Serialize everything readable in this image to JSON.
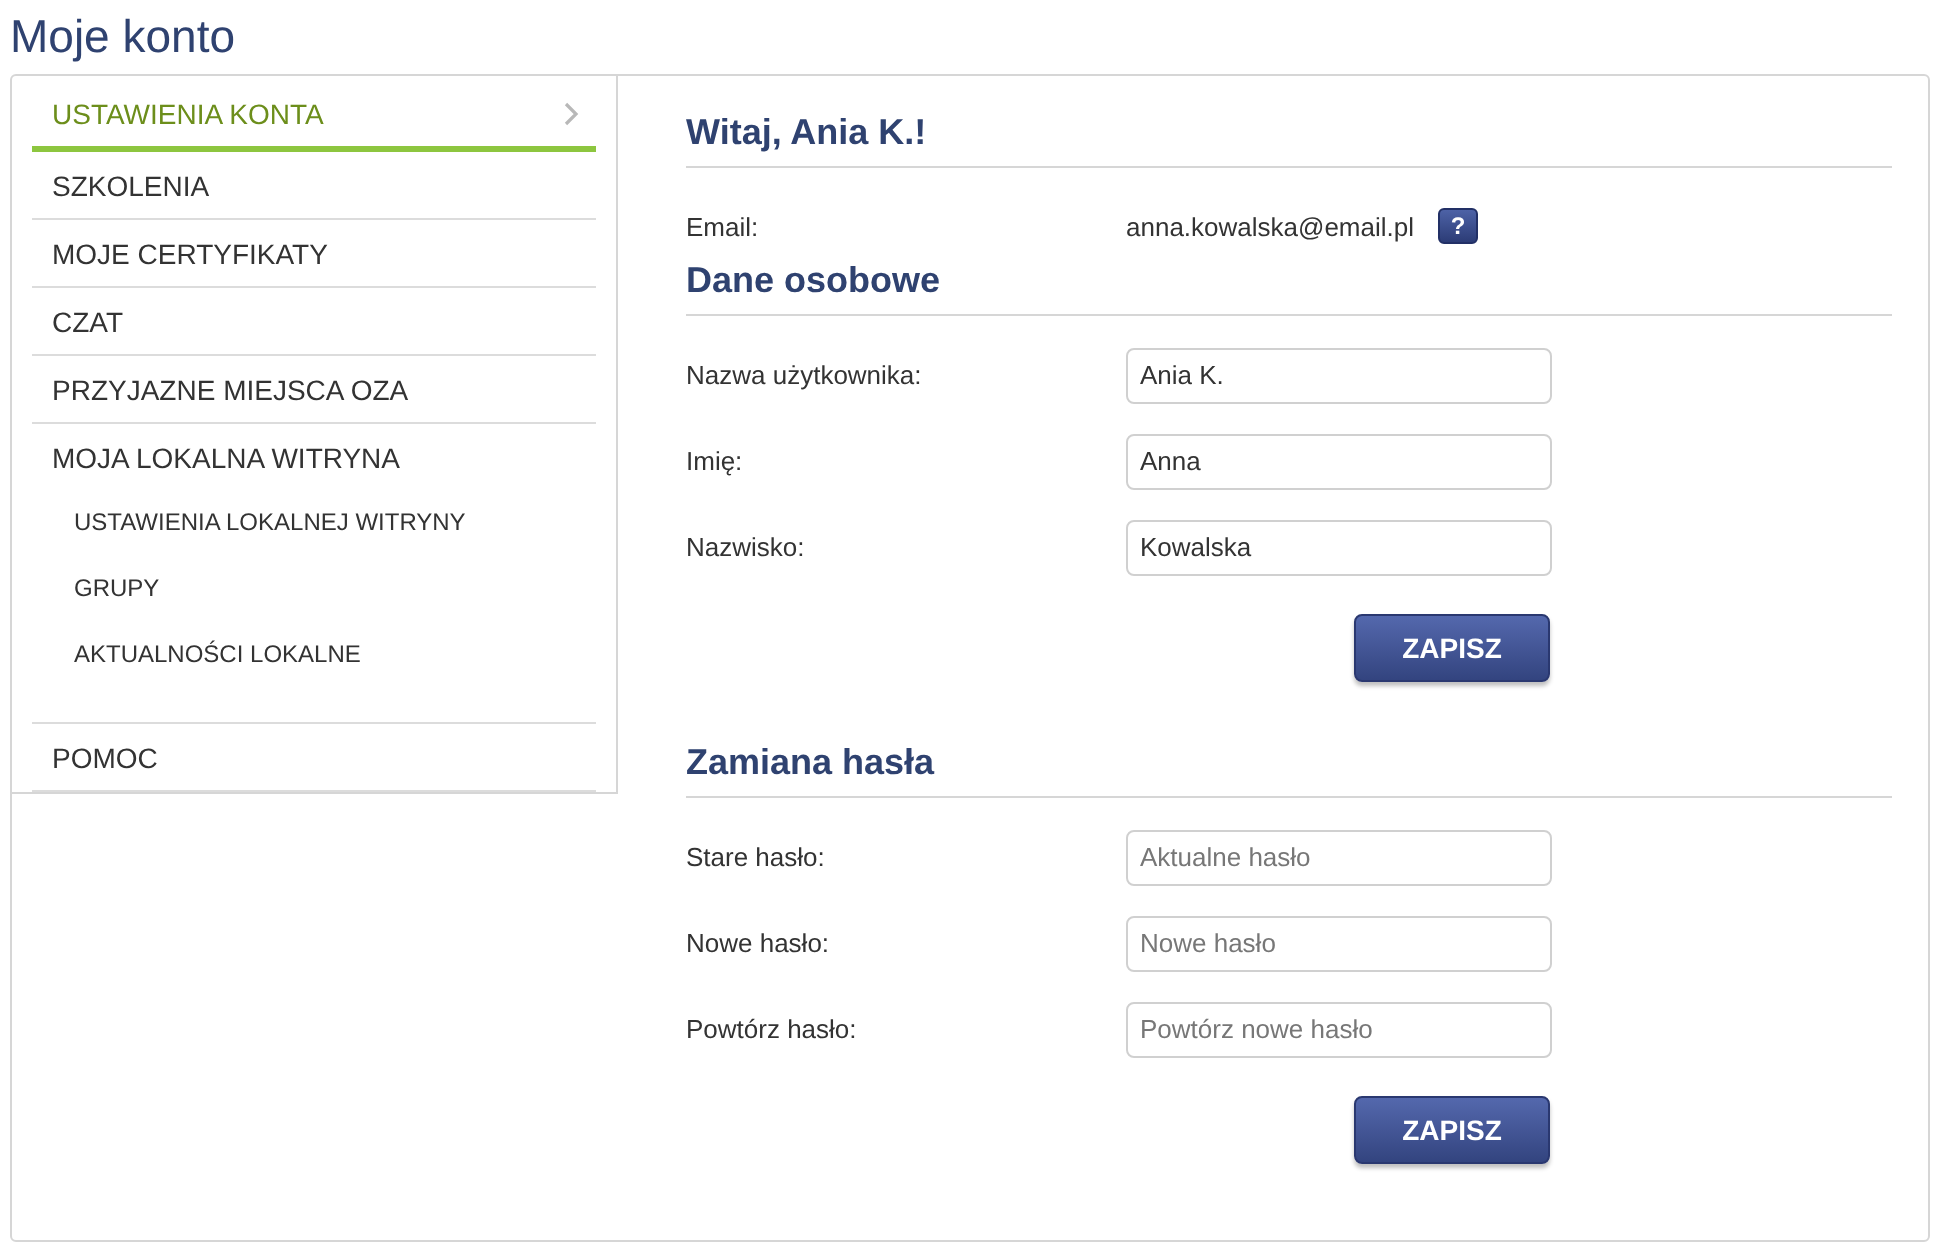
{
  "title": "Moje konto",
  "sidebar": {
    "items": [
      {
        "label": "USTAWIENIA KONTA",
        "selected": true
      },
      {
        "label": "SZKOLENIA",
        "selected": false
      },
      {
        "label": "MOJE CERTYFIKATY",
        "selected": false
      },
      {
        "label": "CZAT",
        "selected": false
      },
      {
        "label": "PRZYJAZNE MIEJSCA OZA",
        "selected": false
      },
      {
        "label": "MOJA LOKALNA WITRYNA",
        "selected": false,
        "children": [
          {
            "label": "USTAWIENIA LOKALNEJ WITRYNY",
            "selected": false
          },
          {
            "label": "GRUPY",
            "selected": false
          },
          {
            "label": "AKTUALNOŚCI LOKALNE",
            "selected": false
          }
        ]
      },
      {
        "label": "POMOC",
        "selected": false
      }
    ]
  },
  "sections": [
    {
      "heading": "Witaj, Ania K.!",
      "rows": [
        {
          "kind": "text",
          "label": "Email:",
          "value": "anna.kowalska@email.pl",
          "help": "?"
        }
      ]
    },
    {
      "heading": "Dane osobowe",
      "rows": [
        {
          "kind": "input",
          "label": "Nazwa użytkownika:",
          "value": "Ania K."
        },
        {
          "kind": "input",
          "label": "Imię:",
          "value": "Anna"
        },
        {
          "kind": "input",
          "label": "Nazwisko:",
          "value": "Kowalska"
        }
      ],
      "button": "ZAPISZ"
    },
    {
      "heading": "Zamiana hasła",
      "rows": [
        {
          "kind": "input",
          "label": "Stare hasło:",
          "placeholder": "Aktualne hasło"
        },
        {
          "kind": "input",
          "label": "Nowe hasło:",
          "placeholder": "Nowe hasło"
        },
        {
          "kind": "input",
          "label": "Powtórz hasło:",
          "placeholder": "Powtórz nowe hasło"
        }
      ],
      "button": "ZAPISZ"
    }
  ]
}
